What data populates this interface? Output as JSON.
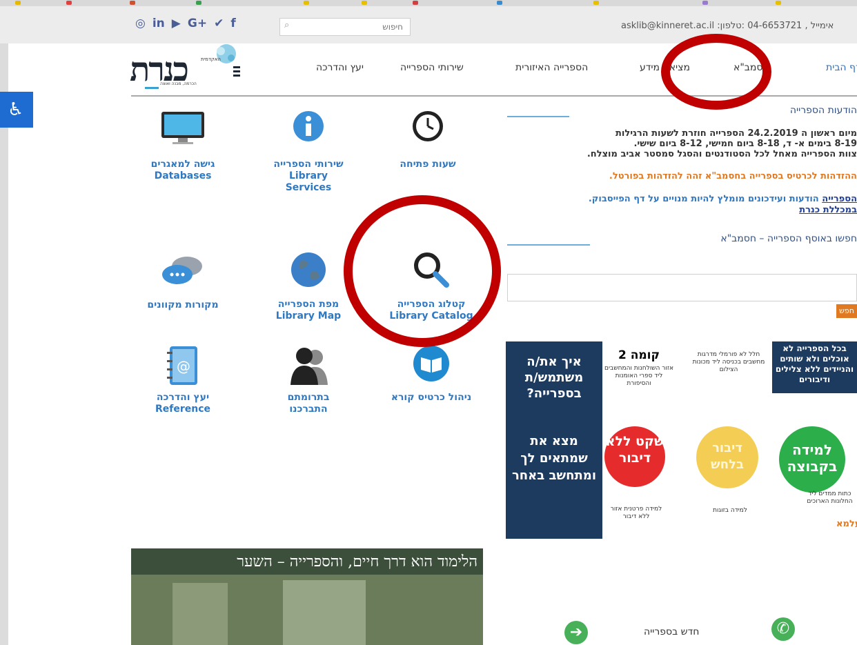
{
  "colors": {
    "accent_blue": "#2f78c2",
    "orange": "#e07a22",
    "red_marker": "#c00000",
    "dark_navy": "#1d3a5f",
    "green": "#48b058"
  },
  "topbar": {
    "social_icons": [
      "instagram-icon",
      "linkedin-icon",
      "youtube-icon",
      "google-plus-icon",
      "twitter-icon",
      "facebook-icon"
    ],
    "social_glyphs": [
      "◎",
      "in",
      "▶",
      "G+",
      "✔",
      "f"
    ],
    "search_placeholder": "חיפוש",
    "contact": "asklib@kinneret.ac.il :אימייל , 04-6653721 :טלפון"
  },
  "logo": {
    "word": "כנרת",
    "top_text": "האקדמית",
    "tagline": "הכרמה, מבנה ואוצה"
  },
  "nav": {
    "items": [
      "דף הבית",
      "חסמב\"א",
      "מציאת מידע",
      "הספרייה האיזורית",
      "שירותי הספרייה",
      "יעץ והדרכה"
    ]
  },
  "tiles": [
    {
      "label_he": "שעות פתיחה",
      "label_en": ""
    },
    {
      "label_he": "שירותי הספרייה",
      "label_en": "Library Services"
    },
    {
      "label_he": "גישה למאגרים",
      "label_en": "Databases"
    },
    {
      "label_he": "קטלוג הספרייה",
      "label_en": "Library Catalog"
    },
    {
      "label_he": "מפת הספרייה",
      "label_en": "Library Map"
    },
    {
      "label_he": "מקורות מקוונים",
      "label_en": ""
    },
    {
      "label_he": "ניהול כרטיס קורא",
      "label_en": ""
    },
    {
      "label_he": "בתרומתם התברכנו",
      "label_en": ""
    },
    {
      "label_he": "יעץ והדרכה",
      "label_en": "Reference"
    }
  ],
  "announcements": {
    "heading": "הודעות הספרייה",
    "line1": "מיום ראשון ה 24.2.2019 הספרייה חוזרת לשעות הרגילות",
    "line2": "8-19 בימים א- ד,   8-18  ביום חמישי,    8-12 ביום שישי.",
    "line3": "צוות הספרייה מאחל לכל הסטודנטים  והסגל סמסטר אביב מוצלח.",
    "line4": "ההזדהות לכרטיס בספרייה בחסמב\"א זהה להזדהות בפורטל.",
    "line5a": "הודעות ועידכונים מומלץ להיות מנויים על דף הפייסבוק.",
    "line5b": "הספרייה",
    "line6": "במכללת כנרת"
  },
  "catalog_search": {
    "heading": "חפשו באוסף הספרייה – חסמב\"א",
    "button": "חפש"
  },
  "poster": {
    "panel_right": "בכל הספרייה לא אוכלים ולא שותים והניידים ללא צלילים ודיבורים",
    "group": "למידה בקבוצה",
    "group_note": "כתות ממדים ליד החלונות הארוכים",
    "quiet_zone": "חלל לא פורמלי מדרגות מחשבים בכניסה ליד מכונות הצילום",
    "whisper": "דיבור בלחש",
    "whisper_note": "למידה בזוגות",
    "floor": "קומה 2",
    "floor_note": "אזור השולחנות והמחשבים ליד ספרי האומנות והסיפורת",
    "silence": "שקט ללא דיבור",
    "silence_note": "למידה פרטנית אזור ללא דיבור",
    "panel_left_top": "איך את/ה משתמש/ת בספרייה?",
    "panel_left_bottom": "מצא את שמתאים לך ומתחשב באחר"
  },
  "bottom": {
    "banner_text": "הלימוד הוא דרך חיים, והספרייה – השער",
    "news": "חדש בספרייה",
    "alma": "עלמא"
  }
}
